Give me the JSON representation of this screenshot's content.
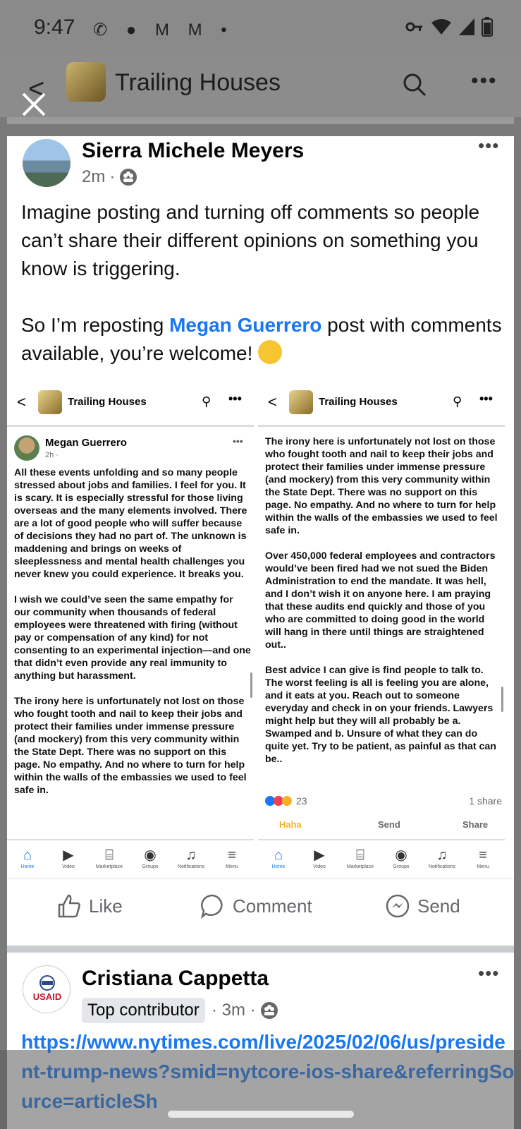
{
  "status_bar": {
    "time": "9:47",
    "notif_icons": "✆ ● M M •"
  },
  "group_header": {
    "name": "Trailing Houses"
  },
  "post": {
    "author": "Sierra Michele Meyers",
    "time": "2m",
    "paragraph1": "Imagine posting and turning off comments so people can’t share their different opinions on something you know is triggering.",
    "paragraph2_prefix": "So I’m reposting ",
    "mention": "Megan Guerrero",
    "paragraph2_suffix": " post with comments available, you’re welcome! ",
    "emoji": "laughing-emoji"
  },
  "embedded": {
    "group_name": "Trailing Houses",
    "left": {
      "author": "Megan Guerrero",
      "time": "2h ·",
      "p1": "All these events unfolding and so many people stressed about jobs and families. I feel for you. It is scary. It is especially stressful for those living overseas and the many elements involved. There are a lot of good people who will suffer because of decisions they had no part of. The unknown is maddening and brings on weeks of sleeplessness and mental health challenges you never knew you could experience. It breaks you.",
      "p2": "I wish we could’ve seen the same empathy for our community when thousands of federal employees were threatened with firing (without pay or compensation of any kind) for not consenting to an experimental injection—and one that didn’t even provide any real immunity to anything but harassment.",
      "p3": "The irony here is unfortunately not lost on those who fought tooth and nail to keep their jobs and protect their families under immense pressure (and mockery) from this very community within the State Dept. There was no support on this page. No empathy. And no where to turn for help within the walls of the embassies we used to feel safe in."
    },
    "right": {
      "p1": "The irony here is unfortunately not lost on those who fought tooth and nail to keep their jobs and protect their families under immense pressure (and mockery) from this very community within the State Dept. There was no support on this page. No empathy. And no where to turn for help within the walls of the embassies we used to feel safe in.",
      "p2": "Over 450,000 federal employees and contractors would’ve been fired had we not sued the Biden Administration to end the mandate. It was hell, and I don’t wish it on anyone here. I am praying that these audits end quickly and those of you who are committed to doing good in the world will hang in there until things are straightened out..",
      "p3": "Best advice I can give is find people to talk to. The worst feeling is all is feeling you are alone, and it eats at you. Reach out to someone everyday and check in on your friends. Lawyers might help but they will all probably be a. Swamped and b. Unsure of what they can do quite yet. Try to be patient, as painful as that can be..",
      "reaction_count": "23",
      "shares": "1 share",
      "haha": "Haha",
      "send": "Send",
      "share": "Share"
    },
    "nav": [
      "Home",
      "Video",
      "Marketplace",
      "Groups",
      "Notifications",
      "Menu"
    ]
  },
  "actions": {
    "like": "Like",
    "comment": "Comment",
    "send": "Send"
  },
  "post2": {
    "author": "Cristiana Cappetta",
    "badge": "Top contributor",
    "time": "· 3m ·",
    "avatar_text": "USAID",
    "link": "https://www.nytimes.com/live/2025/02/06/us/president-trump-news?smid=nytcore-ios-share&referringSource=articleSh"
  },
  "colors": {
    "facebook_blue": "#1877f2",
    "secondary_text": "#65676b"
  }
}
